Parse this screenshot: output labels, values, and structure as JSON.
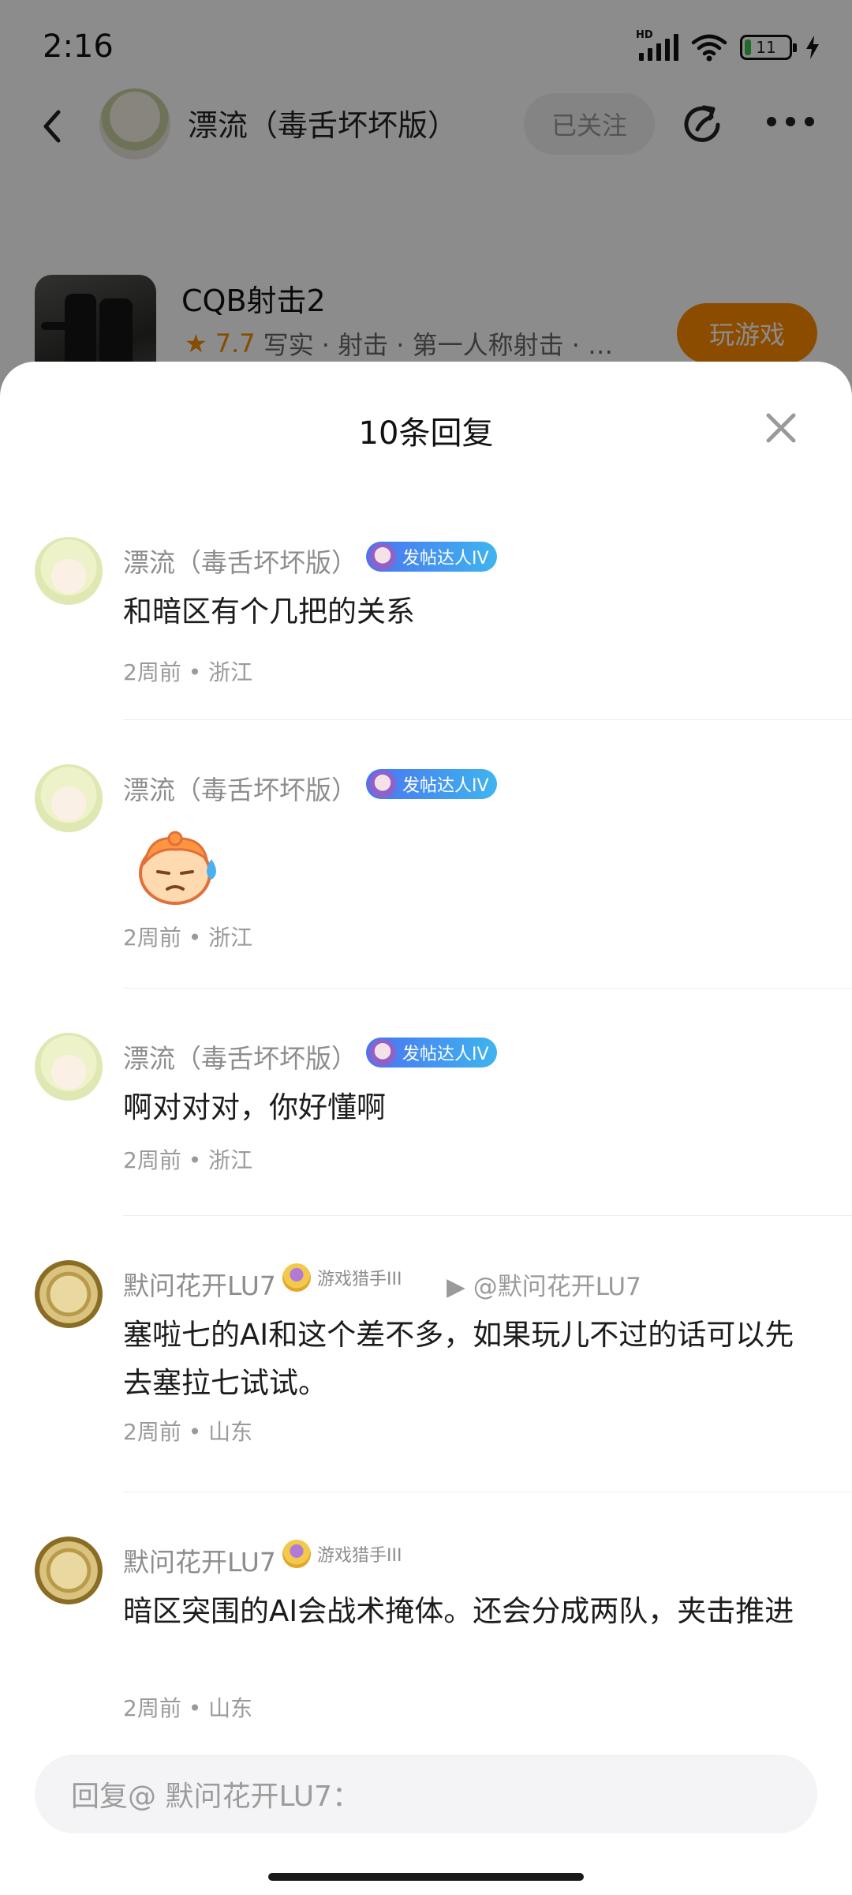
{
  "status_bar": {
    "time": "2:16",
    "network_label": "HD",
    "battery": "11"
  },
  "nav": {
    "user_name": "漂流（毒舌坏坏版）",
    "follow_label": "已关注"
  },
  "game": {
    "title": "CQB射击2",
    "rating": "7.7",
    "tags": "写实 · 射击 · 第一人称射击 · …",
    "play_label": "玩游戏"
  },
  "sheet": {
    "title": "10条回复"
  },
  "replies": [
    {
      "user": "漂流（毒舌坏坏版）",
      "badge": "发帖达人IV",
      "text": "和暗区有个几把的关系",
      "meta": "2周前 • 浙江"
    },
    {
      "user": "漂流（毒舌坏坏版）",
      "badge": "发帖达人IV",
      "text": "",
      "meta": "2周前 • 浙江"
    },
    {
      "user": "漂流（毒舌坏坏版）",
      "badge": "发帖达人IV",
      "text": "啊对对对，你好懂啊",
      "meta": "2周前 • 浙江"
    },
    {
      "user": "默问花开LU7",
      "badge": "游戏猎手III",
      "reply_to": "▶  @默问花开LU7",
      "text": "塞啦七的AI和这个差不多，如果玩儿不过的话可以先去塞拉七试试。",
      "meta": "2周前 • 山东"
    },
    {
      "user": "默问花开LU7",
      "badge": "游戏猎手III",
      "text": "暗区突围的AI会战术掩体。还会分成两队，夹击推进",
      "meta": "2周前 • 山东"
    }
  ],
  "input": {
    "placeholder": "回复@ 默问花开LU7："
  },
  "colors": {
    "accent": "#ff8a00",
    "badge_blue": "#4a74f0",
    "muted_text": "#9a9a9a"
  }
}
